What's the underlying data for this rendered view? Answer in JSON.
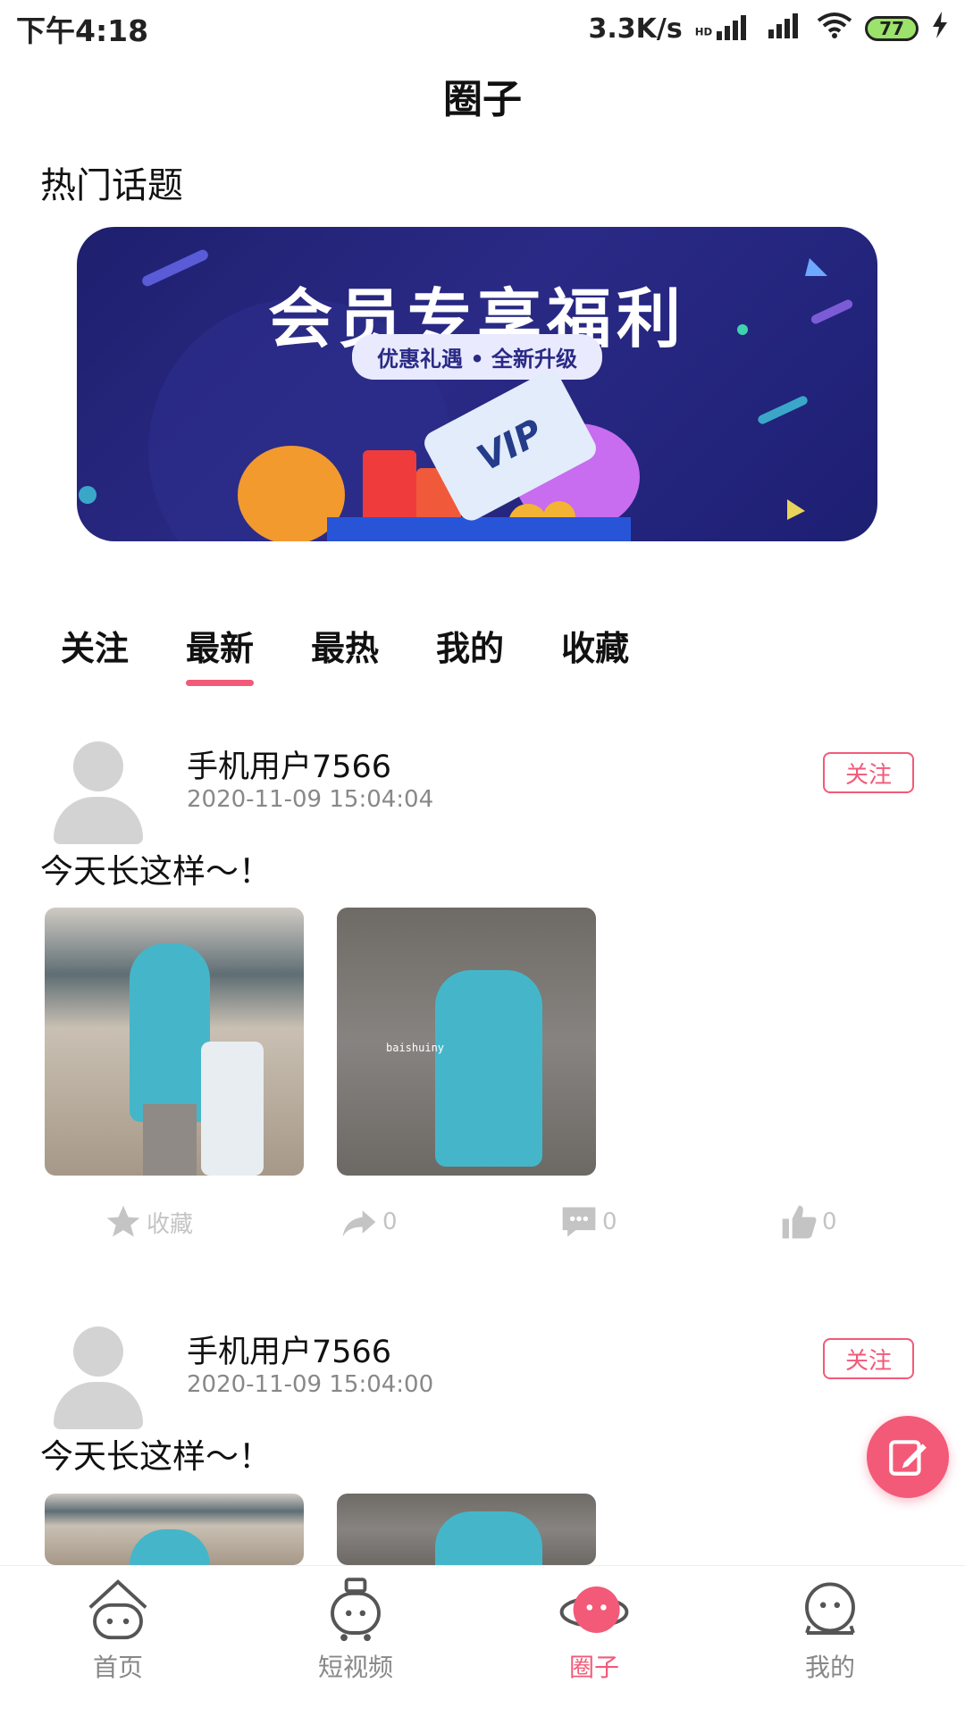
{
  "status_bar": {
    "time": "下午4:18",
    "network_speed": "3.3K/s",
    "hd_badge": "HD",
    "battery": "77"
  },
  "header": {
    "title": "圈子"
  },
  "section": {
    "hot_topics": "热门话题"
  },
  "banner": {
    "title": "会员专享福利",
    "subtitle": "优惠礼遇 • 全新升级",
    "card_text": "VIP"
  },
  "tabs": [
    {
      "label": "关注",
      "active": false
    },
    {
      "label": "最新",
      "active": true
    },
    {
      "label": "最热",
      "active": false
    },
    {
      "label": "我的",
      "active": false
    },
    {
      "label": "收藏",
      "active": false
    }
  ],
  "posts": [
    {
      "username": "手机用户7566",
      "time": "2020-11-09 15:04:04",
      "follow_label": "关注",
      "text": "今天长这样～！",
      "photo_tag": "baishuiny",
      "actions": {
        "favorite_label": "收藏",
        "share_count": "0",
        "comment_count": "0",
        "like_count": "0"
      }
    },
    {
      "username": "手机用户7566",
      "time": "2020-11-09 15:04:00",
      "follow_label": "关注",
      "text": "今天长这样～！"
    }
  ],
  "bottom_nav": [
    {
      "label": "首页",
      "icon": "home-icon"
    },
    {
      "label": "短视频",
      "icon": "video-robot-icon"
    },
    {
      "label": "圈子",
      "icon": "circle-face-icon",
      "active": true
    },
    {
      "label": "我的",
      "icon": "profile-face-icon"
    }
  ],
  "colors": {
    "accent": "#f25a78",
    "muted": "#c4c4c4",
    "banner_bg": "#1f1f6e"
  }
}
